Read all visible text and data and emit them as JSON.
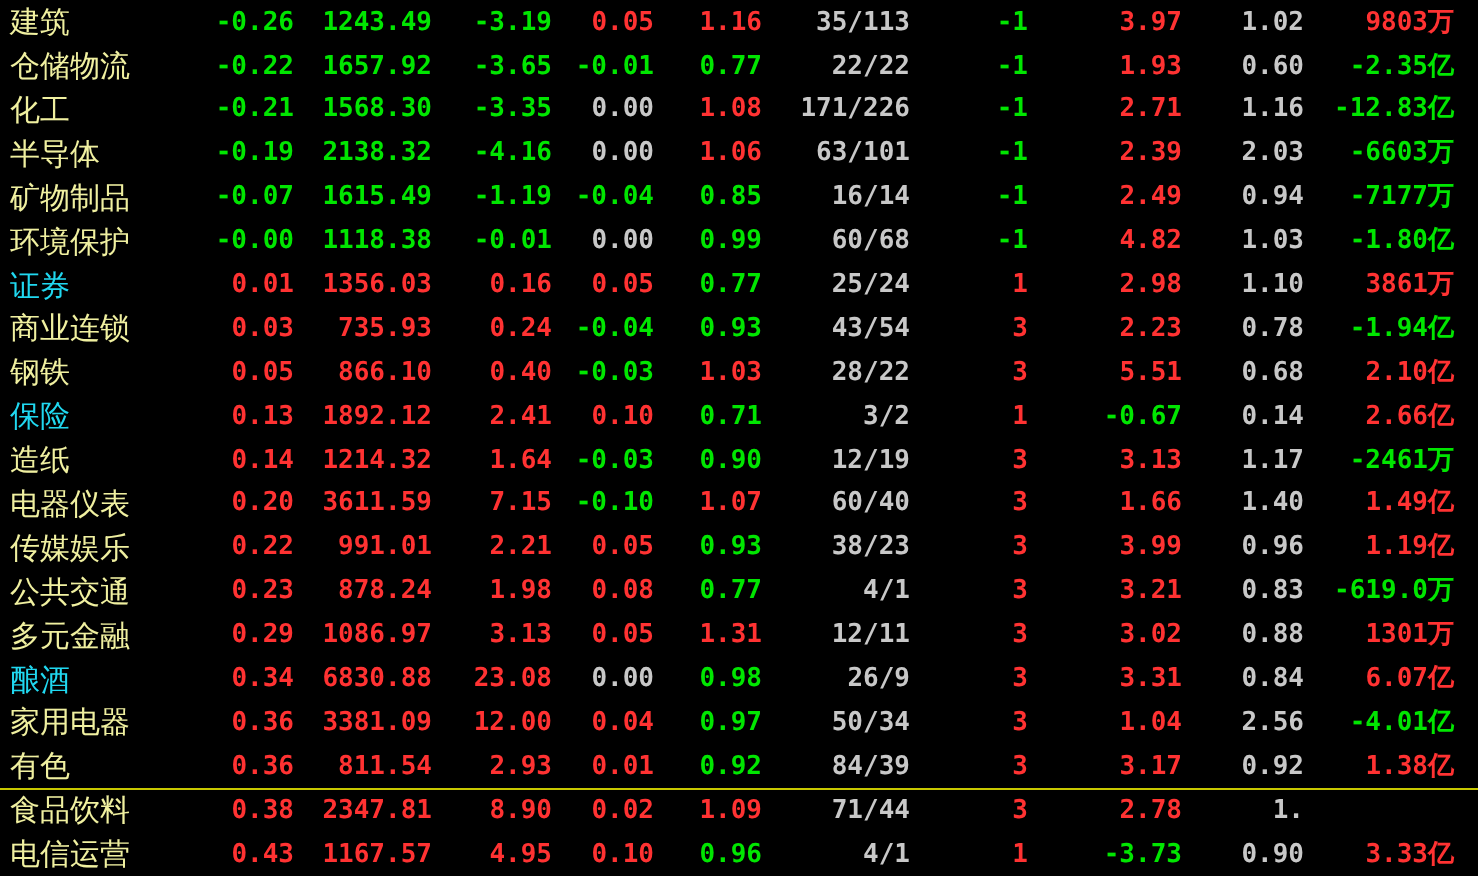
{
  "rows": [
    {
      "name": "建筑",
      "highlighted": false,
      "divider_above": false,
      "cells": [
        {
          "text": "-0.26",
          "color": "#00e600"
        },
        {
          "text": "1243.49",
          "color": "#00e600"
        },
        {
          "text": "-3.19",
          "color": "#00e600"
        },
        {
          "text": "0.05",
          "color": "#ff3232"
        },
        {
          "text": "1.16",
          "color": "#ff3232"
        },
        {
          "text": "35/113",
          "color": "#c8c8c8"
        },
        {
          "text": "-1",
          "color": "#00e600"
        },
        {
          "text": "3.97",
          "color": "#ff3232"
        },
        {
          "text": "1.02",
          "color": "#c8c8c8"
        },
        {
          "text": "9803万",
          "color": "#ff3232"
        }
      ]
    },
    {
      "name": "仓储物流",
      "highlighted": false,
      "divider_above": false,
      "cells": [
        {
          "text": "-0.22",
          "color": "#00e600"
        },
        {
          "text": "1657.92",
          "color": "#00e600"
        },
        {
          "text": "-3.65",
          "color": "#00e600"
        },
        {
          "text": "-0.01",
          "color": "#00e600"
        },
        {
          "text": "0.77",
          "color": "#00e600"
        },
        {
          "text": "22/22",
          "color": "#c8c8c8"
        },
        {
          "text": "-1",
          "color": "#00e600"
        },
        {
          "text": "1.93",
          "color": "#ff3232"
        },
        {
          "text": "0.60",
          "color": "#c8c8c8"
        },
        {
          "text": "-2.35亿",
          "color": "#00e600"
        }
      ]
    },
    {
      "name": "化工",
      "highlighted": false,
      "divider_above": false,
      "cells": [
        {
          "text": "-0.21",
          "color": "#00e600"
        },
        {
          "text": "1568.30",
          "color": "#00e600"
        },
        {
          "text": "-3.35",
          "color": "#00e600"
        },
        {
          "text": "0.00",
          "color": "#c8c8c8"
        },
        {
          "text": "1.08",
          "color": "#ff3232"
        },
        {
          "text": "171/226",
          "color": "#c8c8c8"
        },
        {
          "text": "-1",
          "color": "#00e600"
        },
        {
          "text": "2.71",
          "color": "#ff3232"
        },
        {
          "text": "1.16",
          "color": "#c8c8c8"
        },
        {
          "text": "-12.83亿",
          "color": "#00e600"
        }
      ]
    },
    {
      "name": "半导体",
      "highlighted": false,
      "divider_above": false,
      "cells": [
        {
          "text": "-0.19",
          "color": "#00e600"
        },
        {
          "text": "2138.32",
          "color": "#00e600"
        },
        {
          "text": "-4.16",
          "color": "#00e600"
        },
        {
          "text": "0.00",
          "color": "#c8c8c8"
        },
        {
          "text": "1.06",
          "color": "#ff3232"
        },
        {
          "text": "63/101",
          "color": "#c8c8c8"
        },
        {
          "text": "-1",
          "color": "#00e600"
        },
        {
          "text": "2.39",
          "color": "#ff3232"
        },
        {
          "text": "2.03",
          "color": "#c8c8c8"
        },
        {
          "text": "-6603万",
          "color": "#00e600"
        }
      ]
    },
    {
      "name": "矿物制品",
      "highlighted": false,
      "divider_above": false,
      "cells": [
        {
          "text": "-0.07",
          "color": "#00e600"
        },
        {
          "text": "1615.49",
          "color": "#00e600"
        },
        {
          "text": "-1.19",
          "color": "#00e600"
        },
        {
          "text": "-0.04",
          "color": "#00e600"
        },
        {
          "text": "0.85",
          "color": "#00e600"
        },
        {
          "text": "16/14",
          "color": "#c8c8c8"
        },
        {
          "text": "-1",
          "color": "#00e600"
        },
        {
          "text": "2.49",
          "color": "#ff3232"
        },
        {
          "text": "0.94",
          "color": "#c8c8c8"
        },
        {
          "text": "-7177万",
          "color": "#00e600"
        }
      ]
    },
    {
      "name": "环境保护",
      "highlighted": false,
      "divider_above": false,
      "cells": [
        {
          "text": "-0.00",
          "color": "#00e600"
        },
        {
          "text": "1118.38",
          "color": "#00e600"
        },
        {
          "text": "-0.01",
          "color": "#00e600"
        },
        {
          "text": "0.00",
          "color": "#c8c8c8"
        },
        {
          "text": "0.99",
          "color": "#00e600"
        },
        {
          "text": "60/68",
          "color": "#c8c8c8"
        },
        {
          "text": "-1",
          "color": "#00e600"
        },
        {
          "text": "4.82",
          "color": "#ff3232"
        },
        {
          "text": "1.03",
          "color": "#c8c8c8"
        },
        {
          "text": "-1.80亿",
          "color": "#00e600"
        }
      ]
    },
    {
      "name": "证券",
      "highlighted": true,
      "divider_above": false,
      "cells": [
        {
          "text": "0.01",
          "color": "#ff3232"
        },
        {
          "text": "1356.03",
          "color": "#ff3232"
        },
        {
          "text": "0.16",
          "color": "#ff3232"
        },
        {
          "text": "0.05",
          "color": "#ff3232"
        },
        {
          "text": "0.77",
          "color": "#00e600"
        },
        {
          "text": "25/24",
          "color": "#c8c8c8"
        },
        {
          "text": "1",
          "color": "#ff3232"
        },
        {
          "text": "2.98",
          "color": "#ff3232"
        },
        {
          "text": "1.10",
          "color": "#c8c8c8"
        },
        {
          "text": "3861万",
          "color": "#ff3232"
        }
      ]
    },
    {
      "name": "商业连锁",
      "highlighted": false,
      "divider_above": false,
      "cells": [
        {
          "text": "0.03",
          "color": "#ff3232"
        },
        {
          "text": "735.93",
          "color": "#ff3232"
        },
        {
          "text": "0.24",
          "color": "#ff3232"
        },
        {
          "text": "-0.04",
          "color": "#00e600"
        },
        {
          "text": "0.93",
          "color": "#00e600"
        },
        {
          "text": "43/54",
          "color": "#c8c8c8"
        },
        {
          "text": "3",
          "color": "#ff3232"
        },
        {
          "text": "2.23",
          "color": "#ff3232"
        },
        {
          "text": "0.78",
          "color": "#c8c8c8"
        },
        {
          "text": "-1.94亿",
          "color": "#00e600"
        }
      ]
    },
    {
      "name": "钢铁",
      "highlighted": false,
      "divider_above": false,
      "cells": [
        {
          "text": "0.05",
          "color": "#ff3232"
        },
        {
          "text": "866.10",
          "color": "#ff3232"
        },
        {
          "text": "0.40",
          "color": "#ff3232"
        },
        {
          "text": "-0.03",
          "color": "#00e600"
        },
        {
          "text": "1.03",
          "color": "#ff3232"
        },
        {
          "text": "28/22",
          "color": "#c8c8c8"
        },
        {
          "text": "3",
          "color": "#ff3232"
        },
        {
          "text": "5.51",
          "color": "#ff3232"
        },
        {
          "text": "0.68",
          "color": "#c8c8c8"
        },
        {
          "text": "2.10亿",
          "color": "#ff3232"
        }
      ]
    },
    {
      "name": "保险",
      "highlighted": true,
      "divider_above": false,
      "cells": [
        {
          "text": "0.13",
          "color": "#ff3232"
        },
        {
          "text": "1892.12",
          "color": "#ff3232"
        },
        {
          "text": "2.41",
          "color": "#ff3232"
        },
        {
          "text": "0.10",
          "color": "#ff3232"
        },
        {
          "text": "0.71",
          "color": "#00e600"
        },
        {
          "text": "3/2",
          "color": "#c8c8c8"
        },
        {
          "text": "1",
          "color": "#ff3232"
        },
        {
          "text": "-0.67",
          "color": "#00e600"
        },
        {
          "text": "0.14",
          "color": "#c8c8c8"
        },
        {
          "text": "2.66亿",
          "color": "#ff3232"
        }
      ]
    },
    {
      "name": "造纸",
      "highlighted": false,
      "divider_above": false,
      "cells": [
        {
          "text": "0.14",
          "color": "#ff3232"
        },
        {
          "text": "1214.32",
          "color": "#ff3232"
        },
        {
          "text": "1.64",
          "color": "#ff3232"
        },
        {
          "text": "-0.03",
          "color": "#00e600"
        },
        {
          "text": "0.90",
          "color": "#00e600"
        },
        {
          "text": "12/19",
          "color": "#c8c8c8"
        },
        {
          "text": "3",
          "color": "#ff3232"
        },
        {
          "text": "3.13",
          "color": "#ff3232"
        },
        {
          "text": "1.17",
          "color": "#c8c8c8"
        },
        {
          "text": "-2461万",
          "color": "#00e600"
        }
      ]
    },
    {
      "name": "电器仪表",
      "highlighted": false,
      "divider_above": false,
      "cells": [
        {
          "text": "0.20",
          "color": "#ff3232"
        },
        {
          "text": "3611.59",
          "color": "#ff3232"
        },
        {
          "text": "7.15",
          "color": "#ff3232"
        },
        {
          "text": "-0.10",
          "color": "#00e600"
        },
        {
          "text": "1.07",
          "color": "#ff3232"
        },
        {
          "text": "60/40",
          "color": "#c8c8c8"
        },
        {
          "text": "3",
          "color": "#ff3232"
        },
        {
          "text": "1.66",
          "color": "#ff3232"
        },
        {
          "text": "1.40",
          "color": "#c8c8c8"
        },
        {
          "text": "1.49亿",
          "color": "#ff3232"
        }
      ]
    },
    {
      "name": "传媒娱乐",
      "highlighted": false,
      "divider_above": false,
      "cells": [
        {
          "text": "0.22",
          "color": "#ff3232"
        },
        {
          "text": "991.01",
          "color": "#ff3232"
        },
        {
          "text": "2.21",
          "color": "#ff3232"
        },
        {
          "text": "0.05",
          "color": "#ff3232"
        },
        {
          "text": "0.93",
          "color": "#00e600"
        },
        {
          "text": "38/23",
          "color": "#c8c8c8"
        },
        {
          "text": "3",
          "color": "#ff3232"
        },
        {
          "text": "3.99",
          "color": "#ff3232"
        },
        {
          "text": "0.96",
          "color": "#c8c8c8"
        },
        {
          "text": "1.19亿",
          "color": "#ff3232"
        }
      ]
    },
    {
      "name": "公共交通",
      "highlighted": false,
      "divider_above": false,
      "cells": [
        {
          "text": "0.23",
          "color": "#ff3232"
        },
        {
          "text": "878.24",
          "color": "#ff3232"
        },
        {
          "text": "1.98",
          "color": "#ff3232"
        },
        {
          "text": "0.08",
          "color": "#ff3232"
        },
        {
          "text": "0.77",
          "color": "#00e600"
        },
        {
          "text": "4/1",
          "color": "#c8c8c8"
        },
        {
          "text": "3",
          "color": "#ff3232"
        },
        {
          "text": "3.21",
          "color": "#ff3232"
        },
        {
          "text": "0.83",
          "color": "#c8c8c8"
        },
        {
          "text": "-619.0万",
          "color": "#00e600"
        }
      ]
    },
    {
      "name": "多元金融",
      "highlighted": false,
      "divider_above": false,
      "cells": [
        {
          "text": "0.29",
          "color": "#ff3232"
        },
        {
          "text": "1086.97",
          "color": "#ff3232"
        },
        {
          "text": "3.13",
          "color": "#ff3232"
        },
        {
          "text": "0.05",
          "color": "#ff3232"
        },
        {
          "text": "1.31",
          "color": "#ff3232"
        },
        {
          "text": "12/11",
          "color": "#c8c8c8"
        },
        {
          "text": "3",
          "color": "#ff3232"
        },
        {
          "text": "3.02",
          "color": "#ff3232"
        },
        {
          "text": "0.88",
          "color": "#c8c8c8"
        },
        {
          "text": "1301万",
          "color": "#ff3232"
        }
      ]
    },
    {
      "name": "酿酒",
      "highlighted": true,
      "divider_above": false,
      "cells": [
        {
          "text": "0.34",
          "color": "#ff3232"
        },
        {
          "text": "6830.88",
          "color": "#ff3232"
        },
        {
          "text": "23.08",
          "color": "#ff3232"
        },
        {
          "text": "0.00",
          "color": "#c8c8c8"
        },
        {
          "text": "0.98",
          "color": "#00e600"
        },
        {
          "text": "26/9",
          "color": "#c8c8c8"
        },
        {
          "text": "3",
          "color": "#ff3232"
        },
        {
          "text": "3.31",
          "color": "#ff3232"
        },
        {
          "text": "0.84",
          "color": "#c8c8c8"
        },
        {
          "text": "6.07亿",
          "color": "#ff3232"
        }
      ]
    },
    {
      "name": "家用电器",
      "highlighted": false,
      "divider_above": false,
      "cells": [
        {
          "text": "0.36",
          "color": "#ff3232"
        },
        {
          "text": "3381.09",
          "color": "#ff3232"
        },
        {
          "text": "12.00",
          "color": "#ff3232"
        },
        {
          "text": "0.04",
          "color": "#ff3232"
        },
        {
          "text": "0.97",
          "color": "#00e600"
        },
        {
          "text": "50/34",
          "color": "#c8c8c8"
        },
        {
          "text": "3",
          "color": "#ff3232"
        },
        {
          "text": "1.04",
          "color": "#ff3232"
        },
        {
          "text": "2.56",
          "color": "#c8c8c8"
        },
        {
          "text": "-4.01亿",
          "color": "#00e600"
        }
      ]
    },
    {
      "name": "有色",
      "highlighted": false,
      "divider_above": false,
      "cells": [
        {
          "text": "0.36",
          "color": "#ff3232"
        },
        {
          "text": "811.54",
          "color": "#ff3232"
        },
        {
          "text": "2.93",
          "color": "#ff3232"
        },
        {
          "text": "0.01",
          "color": "#ff3232"
        },
        {
          "text": "0.92",
          "color": "#00e600"
        },
        {
          "text": "84/39",
          "color": "#c8c8c8"
        },
        {
          "text": "3",
          "color": "#ff3232"
        },
        {
          "text": "3.17",
          "color": "#ff3232"
        },
        {
          "text": "0.92",
          "color": "#c8c8c8"
        },
        {
          "text": "1.38亿",
          "color": "#ff3232"
        }
      ]
    },
    {
      "name": "食品饮料",
      "highlighted": false,
      "divider_above": true,
      "cells": [
        {
          "text": "0.38",
          "color": "#ff3232"
        },
        {
          "text": "2347.81",
          "color": "#ff3232"
        },
        {
          "text": "8.90",
          "color": "#ff3232"
        },
        {
          "text": "0.02",
          "color": "#ff3232"
        },
        {
          "text": "1.09",
          "color": "#ff3232"
        },
        {
          "text": "71/44",
          "color": "#c8c8c8"
        },
        {
          "text": "3",
          "color": "#ff3232"
        },
        {
          "text": "2.78",
          "color": "#ff3232"
        },
        {
          "text": "1.",
          "color": "#c8c8c8"
        }
      ]
    },
    {
      "name": "电信运营",
      "highlighted": false,
      "divider_above": false,
      "cells": [
        {
          "text": "0.43",
          "color": "#ff3232"
        },
        {
          "text": "1167.57",
          "color": "#ff3232"
        },
        {
          "text": "4.95",
          "color": "#ff3232"
        },
        {
          "text": "0.10",
          "color": "#ff3232"
        },
        {
          "text": "0.96",
          "color": "#00e600"
        },
        {
          "text": "4/1",
          "color": "#c8c8c8"
        },
        {
          "text": "1",
          "color": "#ff3232"
        },
        {
          "text": "-3.73",
          "color": "#00e600"
        },
        {
          "text": "0.90",
          "color": "#c8c8c8"
        },
        {
          "text": "3.33亿",
          "color": "#ff3232"
        }
      ]
    }
  ]
}
